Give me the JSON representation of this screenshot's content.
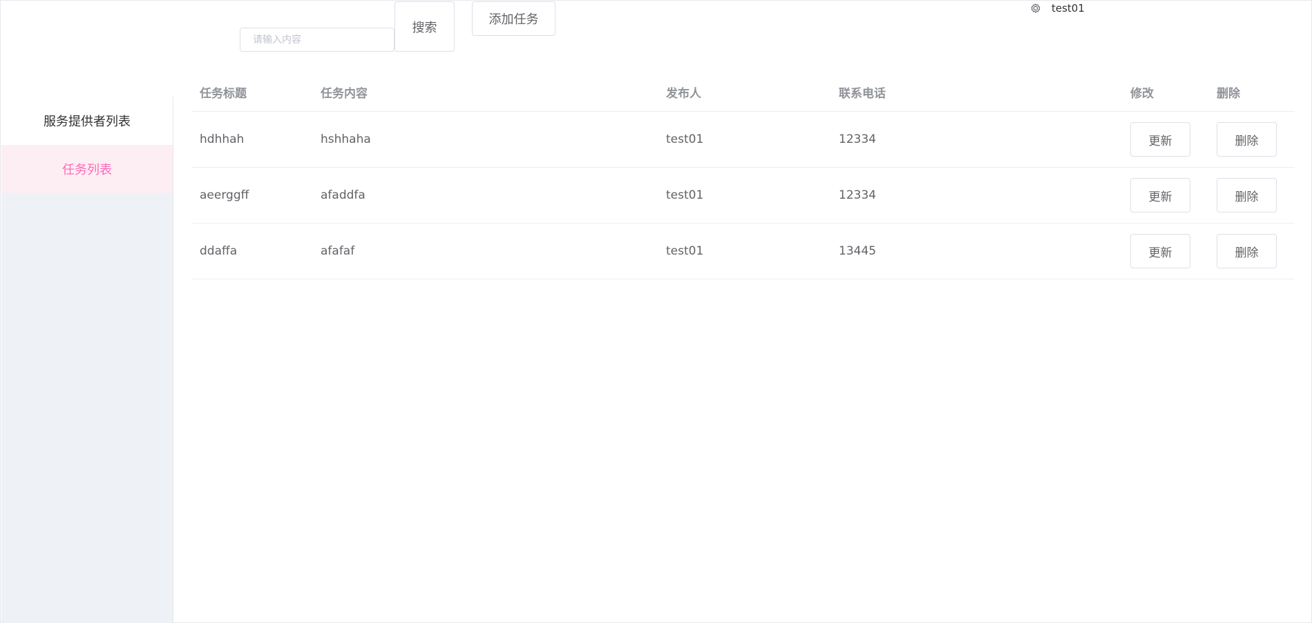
{
  "header": {
    "search_placeholder": "请输入内容",
    "search_value": "",
    "search_button": "搜索",
    "add_button": "添加任务",
    "username": "test01",
    "user_icon": "gear-icon"
  },
  "sidebar": {
    "items": [
      {
        "label": "服务提供者列表",
        "active": false
      },
      {
        "label": "任务列表",
        "active": true
      }
    ]
  },
  "table": {
    "columns": [
      "任务标题",
      "任务内容",
      "发布人",
      "联系电话",
      "修改",
      "删除"
    ],
    "rows": [
      {
        "title": "hdhhah",
        "content": "hshhaha",
        "publisher": "test01",
        "phone": "12334",
        "update_label": "更新",
        "delete_label": "删除"
      },
      {
        "title": "aeerggff",
        "content": "afaddfa",
        "publisher": "test01",
        "phone": "12334",
        "update_label": "更新",
        "delete_label": "删除"
      },
      {
        "title": "ddaffa",
        "content": "afafaf",
        "publisher": "test01",
        "phone": "13445",
        "update_label": "更新",
        "delete_label": "删除"
      }
    ]
  },
  "colors": {
    "accent": "#ff69b4",
    "active_bg": "#fdeef4",
    "sidebar_bg": "#eef1f6",
    "border": "#dcdfe6"
  }
}
